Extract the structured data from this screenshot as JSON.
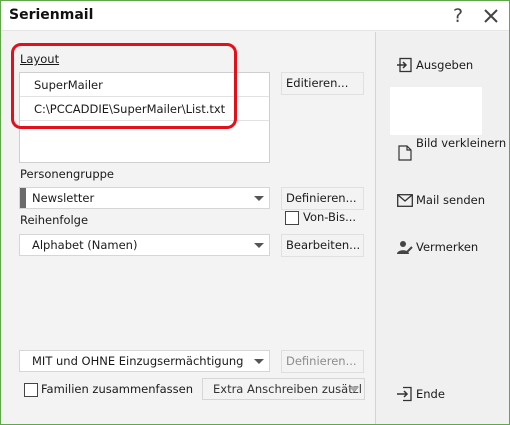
{
  "window": {
    "title": "Serienmail"
  },
  "layout": {
    "label": "Layout",
    "rows": [
      "SuperMailer",
      "C:\\PCCADDIE\\SuperMailer\\List.txt"
    ],
    "edit_button": "Editieren..."
  },
  "personengruppe": {
    "label": "Personengruppe",
    "value": "Newsletter",
    "define_button": "Definieren...",
    "von_bis_label": "Von-Bis..."
  },
  "reihenfolge": {
    "label": "Reihenfolge",
    "value": "Alphabet (Namen)",
    "edit_button": "Bearbeiten..."
  },
  "einzug": {
    "value": "MIT und OHNE Einzugsermächtigung",
    "define_button": "Definieren..."
  },
  "familien": {
    "label": "Familien zusammenfassen",
    "checked": false
  },
  "extra": {
    "value": "Extra Anschreiben zusätzl"
  },
  "sidebar": {
    "ausgeben": "Ausgeben",
    "bild": "Bild verkleinern",
    "mail": "Mail senden",
    "vermerken": "Vermerken",
    "ende": "Ende"
  },
  "colors": {
    "highlight": "#e2101a",
    "window_border": "#5fa84a"
  }
}
